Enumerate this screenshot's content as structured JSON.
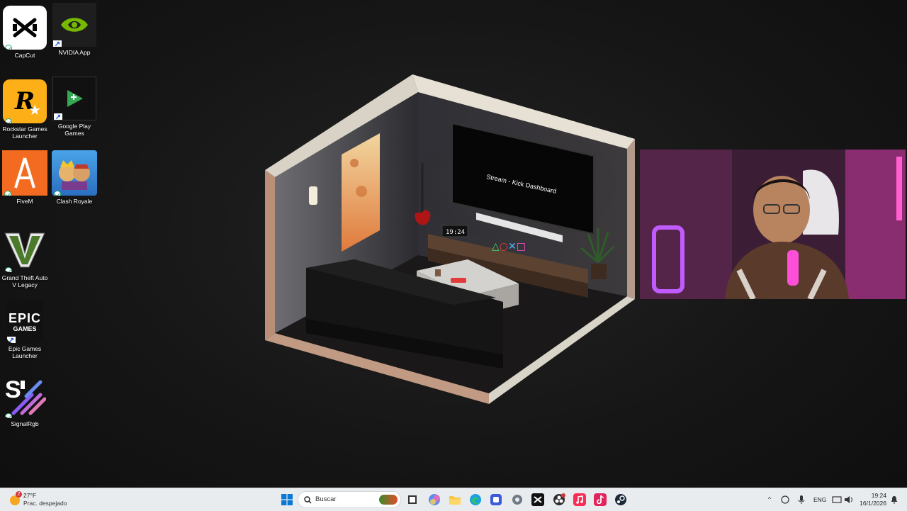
{
  "desktop_icons": [
    {
      "label": "CapCut",
      "icon": "capcut-icon",
      "badge": "sync"
    },
    {
      "label": "NVIDIA App",
      "icon": "nvidia-icon",
      "badge": "shortcut"
    },
    {
      "label": "Rockstar Games Launcher",
      "icon": "rockstar-icon",
      "badge": "sync"
    },
    {
      "label": "Google Play Games",
      "icon": "google-play-games-icon",
      "badge": "shortcut"
    },
    {
      "label": "FiveM",
      "icon": "fivem-icon",
      "badge": "sync"
    },
    {
      "label": "Clash Royale",
      "icon": "clash-royale-icon",
      "badge": "sync"
    },
    {
      "label": "Grand Theft Auto V Legacy",
      "icon": "gta-v-icon",
      "badge": "sync"
    },
    {
      "label": "Epic Games Launcher",
      "icon": "epic-games-icon",
      "badge": "shortcut"
    },
    {
      "label": "SignalRgb",
      "icon": "signalrgb-icon",
      "badge": "sync"
    }
  ],
  "wallpaper": {
    "tv_text": "Stream - Kick Dashboard",
    "clock_text": "19:24"
  },
  "taskbar": {
    "weather": {
      "temp": "27°F",
      "desc": "Prac. despejado",
      "badge_count": "2"
    },
    "search_placeholder": "Buscar",
    "pinned_apps": [
      "windows-start-icon",
      "task-view-icon",
      "copilot-icon",
      "file-explorer-icon",
      "edge-icon",
      "app-icon",
      "settings-icon",
      "capcut-taskbar-icon",
      "obs-icon",
      "apple-music-icon",
      "tiktok-icon",
      "steam-icon"
    ],
    "tray": {
      "language": "ENG",
      "time": "19:24",
      "date": "16/1/2026"
    }
  }
}
